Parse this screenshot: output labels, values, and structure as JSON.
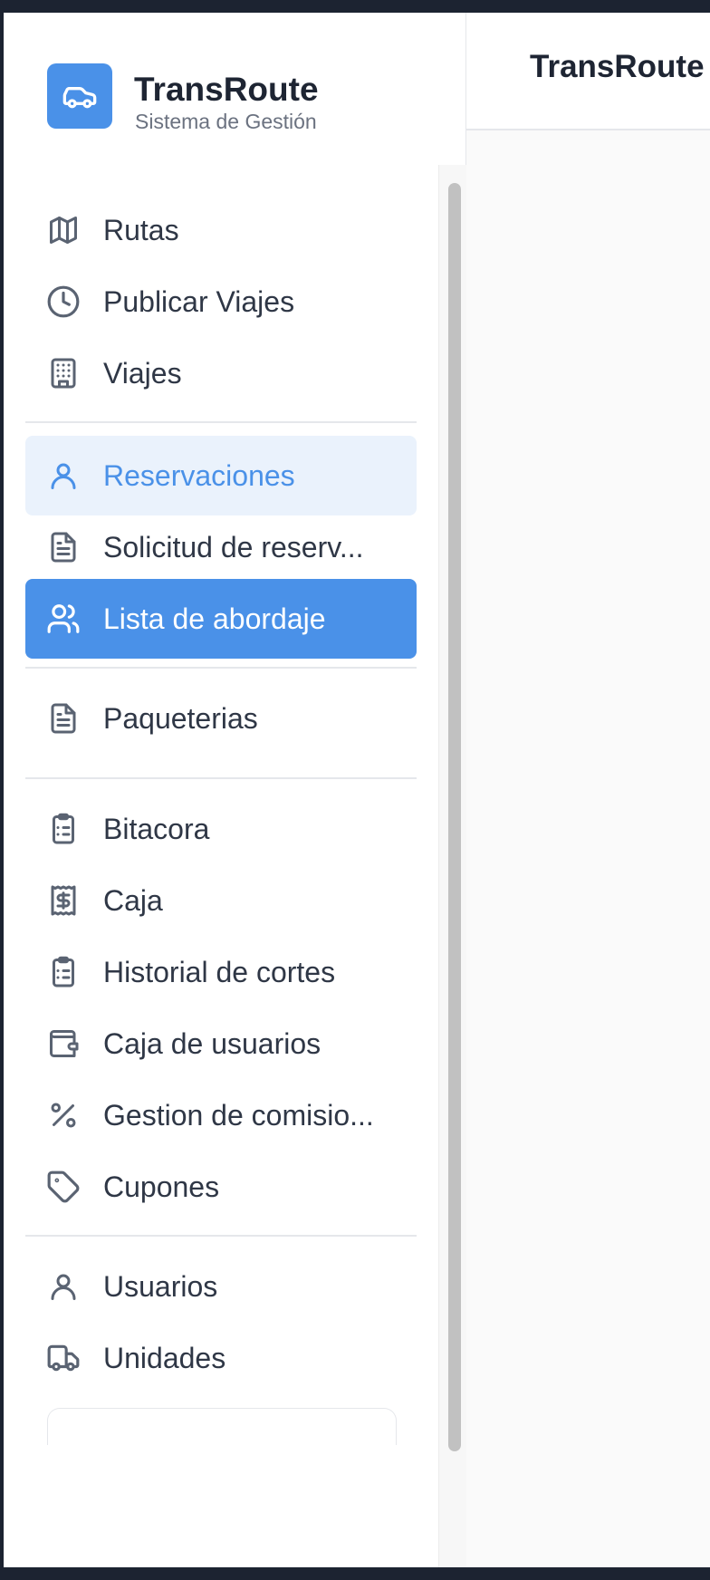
{
  "brand": {
    "title": "TransRoute",
    "subtitle": "Sistema de Gestión"
  },
  "main": {
    "title": "TransRoute"
  },
  "nav": [
    {
      "id": "rutas",
      "label": "Rutas",
      "icon": "map-icon",
      "state": "normal"
    },
    {
      "id": "publicar-viajes",
      "label": "Publicar Viajes",
      "icon": "clock-icon",
      "state": "normal"
    },
    {
      "id": "viajes",
      "label": "Viajes",
      "icon": "building-icon",
      "state": "normal"
    },
    {
      "id": "reservaciones",
      "label": "Reservaciones",
      "icon": "user-icon",
      "state": "highlighted"
    },
    {
      "id": "solicitud-de-reservacion",
      "label": "Solicitud de reserv...",
      "icon": "document-icon",
      "state": "normal"
    },
    {
      "id": "lista-de-abordaje",
      "label": "Lista de abordaje",
      "icon": "users-icon",
      "state": "active"
    },
    {
      "id": "paqueterias",
      "label": "Paqueterias",
      "icon": "document-icon",
      "state": "normal"
    },
    {
      "id": "bitacora",
      "label": "Bitacora",
      "icon": "clipboard-list-icon",
      "state": "normal"
    },
    {
      "id": "caja",
      "label": "Caja",
      "icon": "receipt-dollar-icon",
      "state": "normal"
    },
    {
      "id": "historial-de-cortes",
      "label": "Historial de cortes",
      "icon": "clipboard-list-icon",
      "state": "normal"
    },
    {
      "id": "caja-de-usuarios",
      "label": "Caja de usuarios",
      "icon": "wallet-icon",
      "state": "normal"
    },
    {
      "id": "gestion-de-comisiones",
      "label": "Gestion de comisio...",
      "icon": "percent-icon",
      "state": "normal"
    },
    {
      "id": "cupones",
      "label": "Cupones",
      "icon": "tag-icon",
      "state": "normal"
    },
    {
      "id": "usuarios",
      "label": "Usuarios",
      "icon": "user-icon",
      "state": "normal"
    },
    {
      "id": "unidades",
      "label": "Unidades",
      "icon": "truck-icon",
      "state": "normal"
    }
  ],
  "colors": {
    "accent": "#4a91e8",
    "accent_soft": "#eaf2fc",
    "text": "#2f3746",
    "icon": "#5a6372"
  }
}
